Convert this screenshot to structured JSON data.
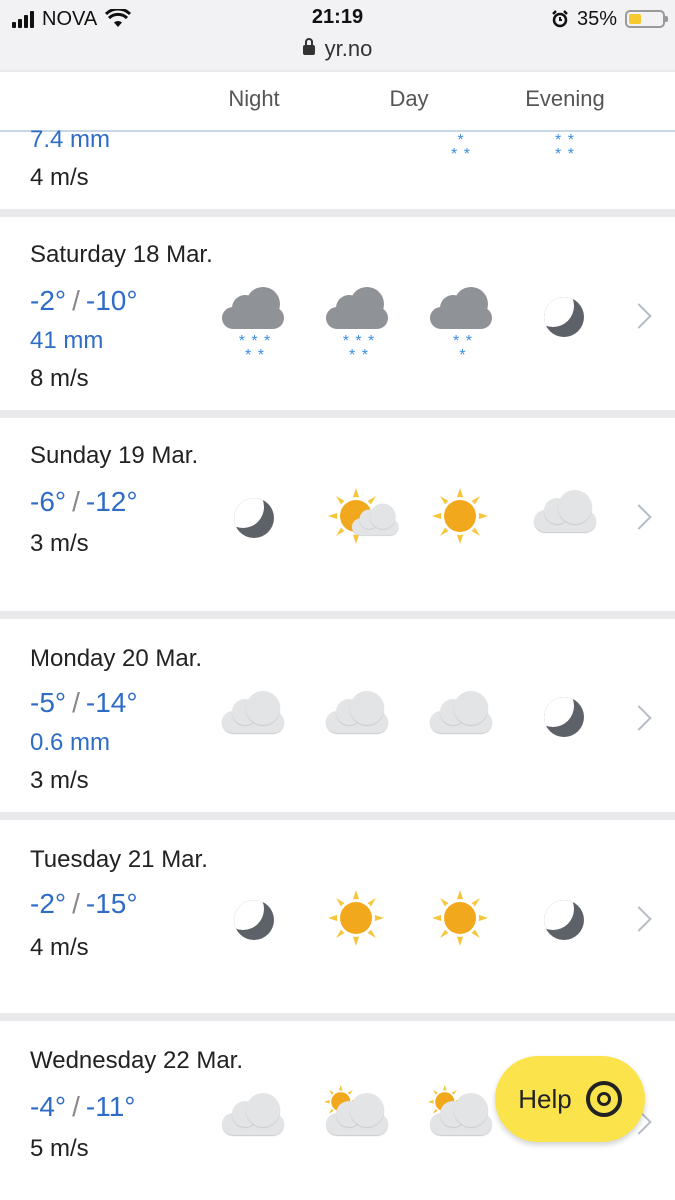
{
  "status_bar": {
    "carrier": "NOVA",
    "time": "21:19",
    "battery": "35%",
    "url": "yr.no"
  },
  "columns": [
    "Night",
    "Day",
    "Evening"
  ],
  "partial_card": {
    "precip": "7.4 mm",
    "wind": "4 m/s",
    "icons": [
      "light-snow-icon",
      "snow-icon"
    ]
  },
  "days": [
    {
      "day": "Saturday 18 Mar.",
      "max": "-2°",
      "min": "-10°",
      "precip": "41 mm",
      "wind": "8 m/s",
      "icons": [
        "snow-cloud-icon",
        "snow-cloud-icon",
        "light-snow-cloud-icon",
        "moon-icon"
      ]
    },
    {
      "day": "Sunday 19 Mar.",
      "max": "-6°",
      "min": "-12°",
      "precip": "",
      "wind": "3 m/s",
      "icons": [
        "moon-icon",
        "partly-cloudy-sun-icon",
        "sun-icon",
        "cloud-icon"
      ]
    },
    {
      "day": "Monday 20 Mar.",
      "max": "-5°",
      "min": "-14°",
      "precip": "0.6 mm",
      "wind": "3 m/s",
      "icons": [
        "cloud-icon",
        "cloud-icon",
        "cloud-icon",
        "moon-icon"
      ]
    },
    {
      "day": "Tuesday 21 Mar.",
      "max": "-2°",
      "min": "-15°",
      "precip": "",
      "wind": "4 m/s",
      "icons": [
        "moon-icon",
        "sun-icon",
        "sun-icon",
        "moon-icon"
      ]
    },
    {
      "day": "Wednesday 22 Mar.",
      "max": "-4°",
      "min": "-11°",
      "precip": "",
      "wind": "5 m/s",
      "icons": [
        "cloud-icon",
        "sun-behind-cloud-icon",
        "sun-behind-cloud-icon",
        ""
      ]
    }
  ],
  "help": {
    "label": "Help"
  },
  "colors": {
    "temp_text": "#2f6cc8",
    "help_bg": "#fae34b",
    "snow": "#3a8ee8",
    "sun": "#f2a81c"
  }
}
